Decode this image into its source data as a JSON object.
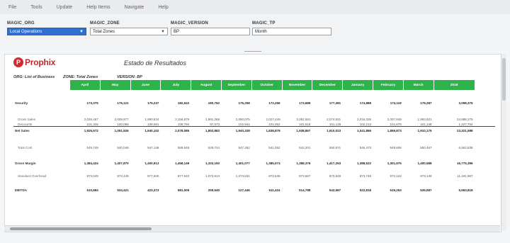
{
  "menubar": {
    "items": [
      "File",
      "Tools",
      "Update",
      "Help Items",
      "Navigate",
      "Help"
    ]
  },
  "filters": [
    {
      "label": "MAGIC_ORG",
      "value": "Local Operations",
      "selected": true,
      "dropdown": true
    },
    {
      "label": "MAGIC_ZONE",
      "value": "Total Zones",
      "selected": false,
      "dropdown": true
    },
    {
      "label": "MAGIC_VERSION",
      "value": "BP",
      "selected": false,
      "dropdown": false
    },
    {
      "label": "MAGIC_TP",
      "value": "Month",
      "selected": false,
      "dropdown": false
    }
  ],
  "report": {
    "logo_text": "Prophix",
    "title": "Estado de Resultados",
    "meta": {
      "org": "ORG: List of Business",
      "zone": "ZONE: Total Zones",
      "version": "VERSION: BP"
    }
  },
  "table": {
    "columns": [
      "April",
      "May",
      "June",
      "July",
      "August",
      "September",
      "October",
      "November",
      "December",
      "January",
      "February",
      "March",
      "2018"
    ],
    "rows": [
      {
        "label": "Security",
        "bold": true,
        "values": [
          "173,375",
          "176,121",
          "175,237",
          "182,522",
          "180,762",
          "175,258",
          "173,256",
          "173,689",
          "177,281",
          "174,888",
          "174,119",
          "179,287",
          "2,098,375"
        ]
      },
      {
        "label": "Gross Sales",
        "indent": true,
        "values": [
          "2,026,467",
          "2,009,877",
          "1,990,834",
          "2,156,879",
          "1,991,269",
          "2,090,075",
          "2,027,449",
          "2,052,551",
          "2,074,931",
          "2,016,336",
          "2,007,849",
          "1,993,921",
          "24,888,275"
        ]
      },
      {
        "label": "Discounts",
        "indent": true,
        "values": [
          "101,325",
          "100,098",
          "108,591",
          "108,794",
          "97,573",
          "102,944",
          "101,052",
          "101,518",
          "101,128",
          "102,213",
          "101,878",
          "101,148",
          "1,227,754"
        ]
      },
      {
        "label": "Net Sales",
        "bold": true,
        "values": [
          "1,925,572",
          "1,051,926",
          "1,940,102",
          "2,078,085",
          "1,853,883",
          "1,940,328",
          "1,838,878",
          "1,938,867",
          "1,910,023",
          "1,041,866",
          "1,859,873",
          "1,910,175",
          "23,321,588"
        ]
      },
      {
        "label": "Total Cost",
        "indent": true,
        "values": [
          "549,749",
          "540,049",
          "547,149",
          "569,646",
          "528,724",
          "547,252",
          "541,052",
          "542,201",
          "550,971",
          "545,473",
          "549,608",
          "550,467",
          "6,552,838"
        ]
      },
      {
        "label": "Gross Margin",
        "bold": true,
        "values": [
          "1,384,424",
          "1,407,870",
          "1,400,913",
          "1,458,149",
          "1,333,150",
          "1,401,077",
          "1,385,074",
          "1,388,376",
          "1,417,253",
          "1,388,522",
          "1,301,675",
          "1,400,588",
          "16,775,396"
        ]
      },
      {
        "label": "Standard Overhead",
        "indent": true,
        "values": [
          "873,049",
          "873,449",
          "977,840",
          "877,940",
          "1,073,813",
          "1,273,631",
          "873,649",
          "873,667",
          "873,649",
          "873,748",
          "873,122",
          "873,149",
          "11,181,967"
        ]
      },
      {
        "label": "EBITDA",
        "bold": true,
        "values": [
          "510,884",
          "534,421",
          "423,373",
          "581,009",
          "259,540",
          "127,446",
          "511,424",
          "514,788",
          "543,587",
          "522,818",
          "519,253",
          "539,987",
          "5,593,818"
        ]
      }
    ]
  }
}
